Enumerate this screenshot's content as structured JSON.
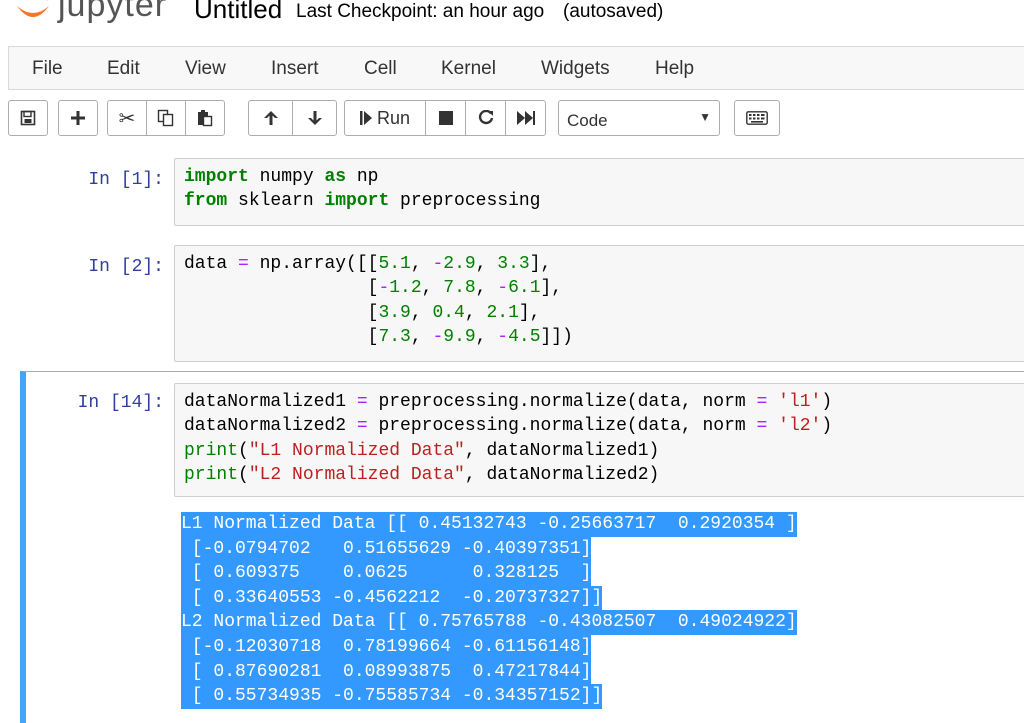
{
  "header": {
    "logo_text": "jupyter",
    "notebook_name": "Untitled",
    "checkpoint": "Last Checkpoint: an hour ago",
    "autosave": "(autosaved)"
  },
  "menubar": [
    "File",
    "Edit",
    "View",
    "Insert",
    "Cell",
    "Kernel",
    "Widgets",
    "Help"
  ],
  "toolbar": {
    "run_label": "Run",
    "cell_type": "Code",
    "icons": [
      "save-icon",
      "plus-icon",
      "scissors-icon",
      "copy-icon",
      "paste-icon",
      "arrow-up-icon",
      "arrow-down-icon",
      "step-icon",
      "stop-icon",
      "restart-icon",
      "fast-forward-icon",
      "keyboard-icon"
    ]
  },
  "cells": [
    {
      "prompt": "In [1]:",
      "lines": [
        "import numpy as np",
        "from sklearn import preprocessing"
      ]
    },
    {
      "prompt": "In [2]:",
      "lines": [
        "data = np.array([[5.1, -2.9, 3.3],",
        "                 [-1.2, 7.8, -6.1],",
        "                 [3.9, 0.4, 2.1],",
        "                 [7.3, -9.9, -4.5]])"
      ]
    },
    {
      "prompt": "In [14]:",
      "lines": [
        "dataNormalized1 = preprocessing.normalize(data, norm = 'l1')",
        "dataNormalized2 = preprocessing.normalize(data, norm = 'l2')",
        "print(\"L1 Normalized Data\", dataNormalized1)",
        "print(\"L2 Normalized Data\", dataNormalized2)"
      ]
    }
  ],
  "output": [
    "L1 Normalized Data [[ 0.45132743 -0.25663717  0.2920354 ]",
    " [-0.0794702   0.51655629 -0.40397351]",
    " [ 0.609375    0.0625      0.328125  ]",
    " [ 0.33640553 -0.4562212  -0.20737327]]",
    "L2 Normalized Data [[ 0.75765788 -0.43082507  0.49024922]",
    " [-0.12030718  0.78199664 -0.61156148]",
    " [ 0.87690281  0.08993875  0.47217844]",
    " [ 0.55734935 -0.75585734 -0.34357152]]"
  ],
  "colors": {
    "selected_cell_bar": "#42a5f5",
    "output_highlight": "#3399ff",
    "prompt": "#303f9f",
    "keyword": "#008000"
  }
}
